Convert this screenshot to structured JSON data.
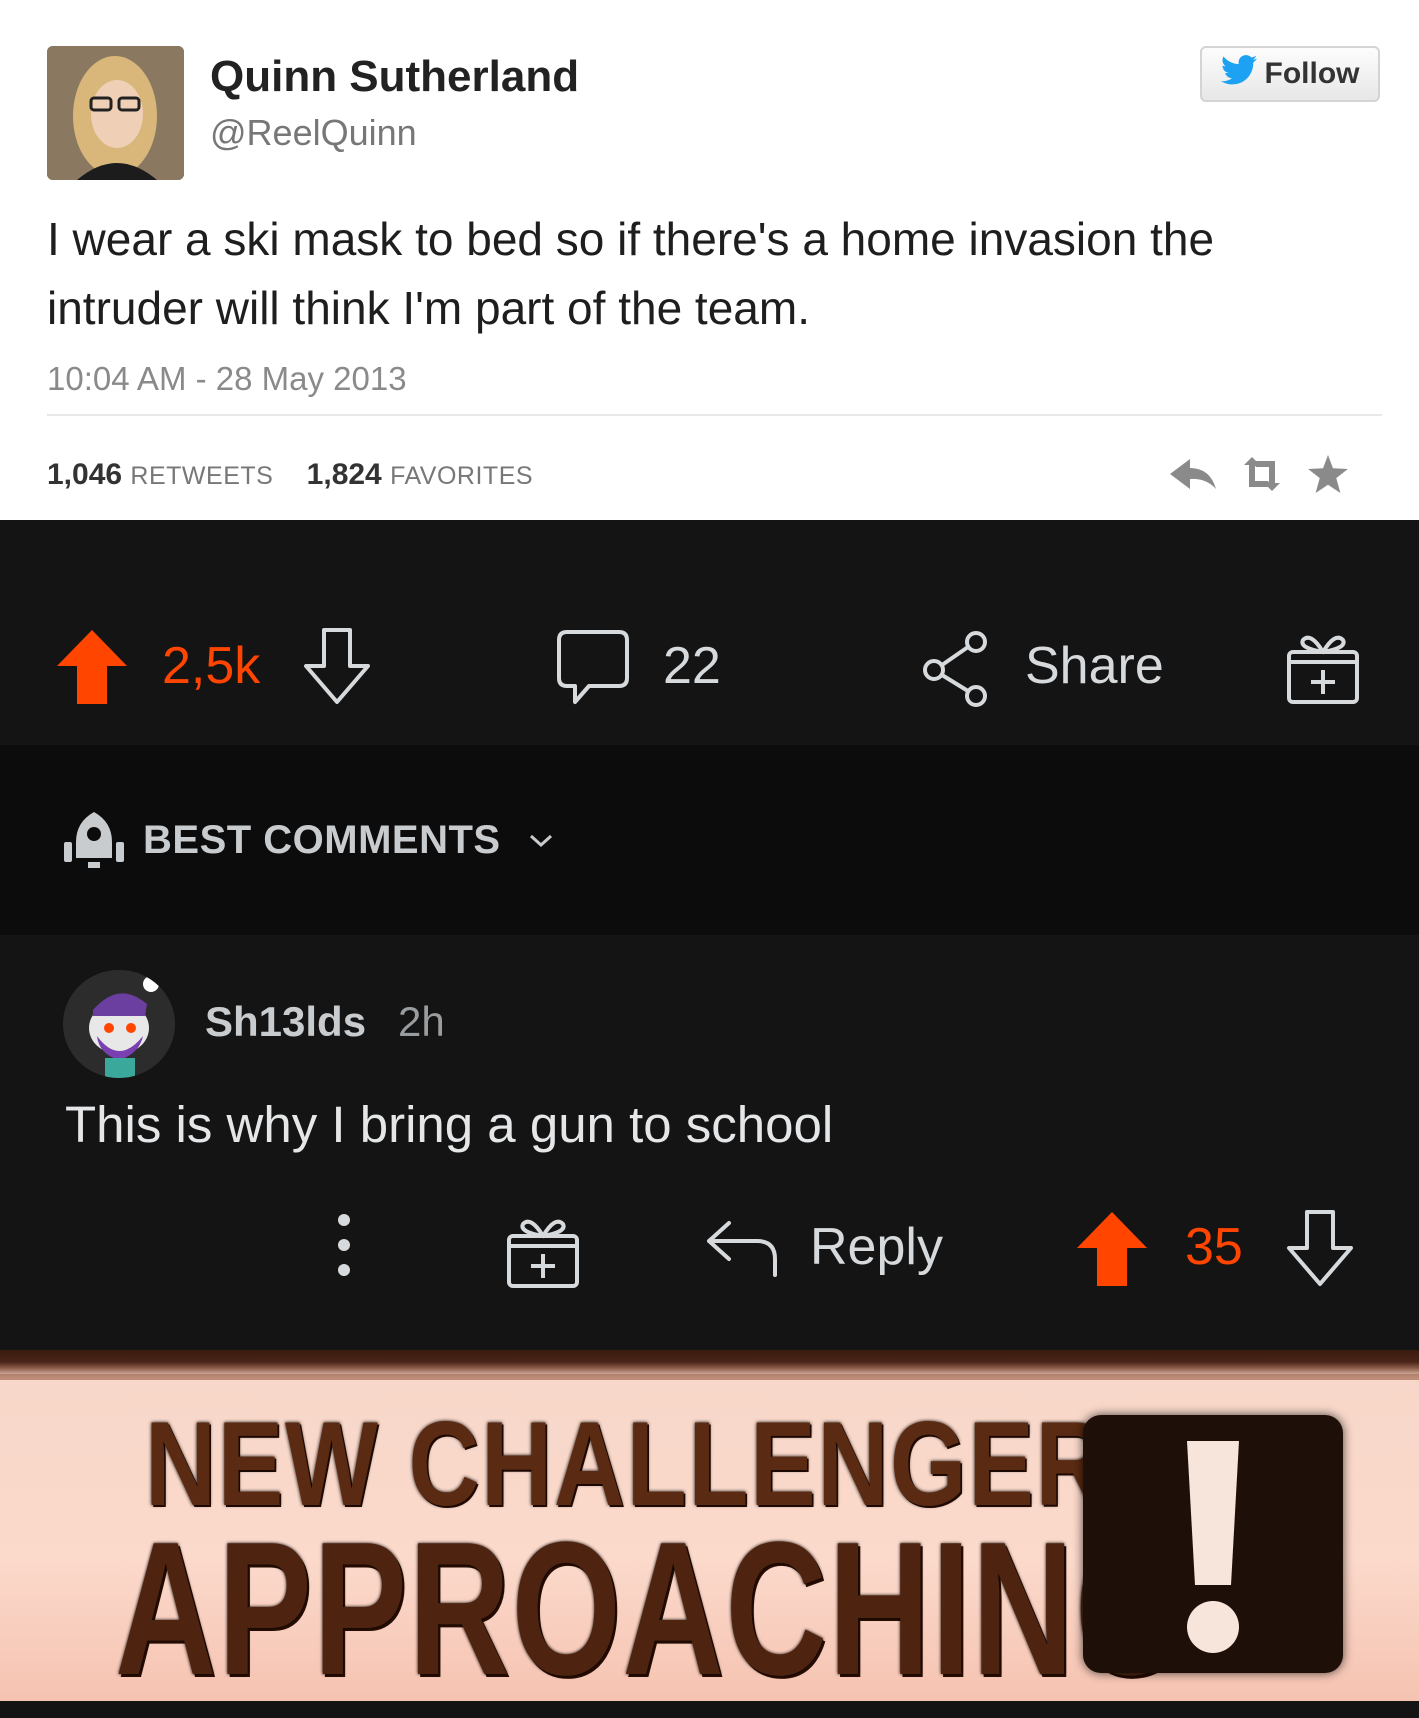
{
  "tweet": {
    "name": "Quinn Sutherland",
    "handle": "@ReelQuinn",
    "follow_label": "Follow",
    "text": "I wear a ski mask to bed so if there's a home invasion the intruder will think I'm part of the team.",
    "timestamp": "10:04 AM - 28 May 2013",
    "retweets_count": "1,046",
    "retweets_label": "RETWEETS",
    "favorites_count": "1,824",
    "favorites_label": "FAVORITES",
    "follow_color": "#1da1f2"
  },
  "post_bar": {
    "score": "2,5k",
    "comments": "22",
    "share_label": "Share",
    "accent": "#ff4500"
  },
  "sort": {
    "label": "BEST COMMENTS"
  },
  "comment": {
    "username": "Sh13lds",
    "age": "2h",
    "body": "This is why I bring a gun to school",
    "reply_label": "Reply",
    "score": "35"
  },
  "banner": {
    "line1": "NEW CHALLENGER",
    "line2": "APPROACHING"
  },
  "icons": [
    "reply-arrow-icon",
    "retweet-icon",
    "favorite-star-icon",
    "twitter-bird-icon",
    "upvote-icon",
    "downvote-icon",
    "comment-bubble-icon",
    "share-icon",
    "award-gift-icon",
    "rocket-sort-icon",
    "chevron-down-icon",
    "more-dots-icon",
    "reply-icon",
    "exclamation-icon"
  ]
}
